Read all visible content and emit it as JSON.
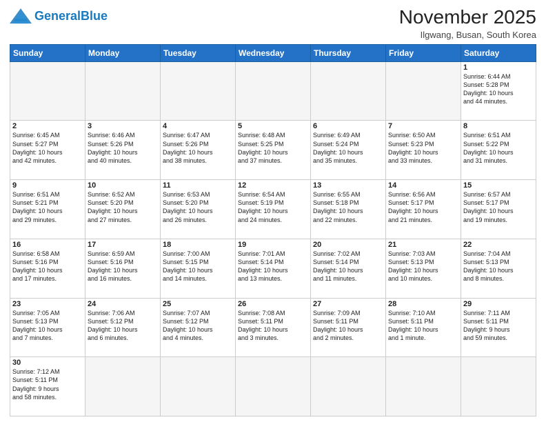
{
  "header": {
    "logo_general": "General",
    "logo_blue": "Blue",
    "title": "November 2025",
    "location": "Ilgwang, Busan, South Korea"
  },
  "days_of_week": [
    "Sunday",
    "Monday",
    "Tuesday",
    "Wednesday",
    "Thursday",
    "Friday",
    "Saturday"
  ],
  "weeks": [
    [
      {
        "day": "",
        "info": ""
      },
      {
        "day": "",
        "info": ""
      },
      {
        "day": "",
        "info": ""
      },
      {
        "day": "",
        "info": ""
      },
      {
        "day": "",
        "info": ""
      },
      {
        "day": "",
        "info": ""
      },
      {
        "day": "1",
        "info": "Sunrise: 6:44 AM\nSunset: 5:28 PM\nDaylight: 10 hours\nand 44 minutes."
      }
    ],
    [
      {
        "day": "2",
        "info": "Sunrise: 6:45 AM\nSunset: 5:27 PM\nDaylight: 10 hours\nand 42 minutes."
      },
      {
        "day": "3",
        "info": "Sunrise: 6:46 AM\nSunset: 5:26 PM\nDaylight: 10 hours\nand 40 minutes."
      },
      {
        "day": "4",
        "info": "Sunrise: 6:47 AM\nSunset: 5:26 PM\nDaylight: 10 hours\nand 38 minutes."
      },
      {
        "day": "5",
        "info": "Sunrise: 6:48 AM\nSunset: 5:25 PM\nDaylight: 10 hours\nand 37 minutes."
      },
      {
        "day": "6",
        "info": "Sunrise: 6:49 AM\nSunset: 5:24 PM\nDaylight: 10 hours\nand 35 minutes."
      },
      {
        "day": "7",
        "info": "Sunrise: 6:50 AM\nSunset: 5:23 PM\nDaylight: 10 hours\nand 33 minutes."
      },
      {
        "day": "8",
        "info": "Sunrise: 6:51 AM\nSunset: 5:22 PM\nDaylight: 10 hours\nand 31 minutes."
      }
    ],
    [
      {
        "day": "9",
        "info": "Sunrise: 6:51 AM\nSunset: 5:21 PM\nDaylight: 10 hours\nand 29 minutes."
      },
      {
        "day": "10",
        "info": "Sunrise: 6:52 AM\nSunset: 5:20 PM\nDaylight: 10 hours\nand 27 minutes."
      },
      {
        "day": "11",
        "info": "Sunrise: 6:53 AM\nSunset: 5:20 PM\nDaylight: 10 hours\nand 26 minutes."
      },
      {
        "day": "12",
        "info": "Sunrise: 6:54 AM\nSunset: 5:19 PM\nDaylight: 10 hours\nand 24 minutes."
      },
      {
        "day": "13",
        "info": "Sunrise: 6:55 AM\nSunset: 5:18 PM\nDaylight: 10 hours\nand 22 minutes."
      },
      {
        "day": "14",
        "info": "Sunrise: 6:56 AM\nSunset: 5:17 PM\nDaylight: 10 hours\nand 21 minutes."
      },
      {
        "day": "15",
        "info": "Sunrise: 6:57 AM\nSunset: 5:17 PM\nDaylight: 10 hours\nand 19 minutes."
      }
    ],
    [
      {
        "day": "16",
        "info": "Sunrise: 6:58 AM\nSunset: 5:16 PM\nDaylight: 10 hours\nand 17 minutes."
      },
      {
        "day": "17",
        "info": "Sunrise: 6:59 AM\nSunset: 5:16 PM\nDaylight: 10 hours\nand 16 minutes."
      },
      {
        "day": "18",
        "info": "Sunrise: 7:00 AM\nSunset: 5:15 PM\nDaylight: 10 hours\nand 14 minutes."
      },
      {
        "day": "19",
        "info": "Sunrise: 7:01 AM\nSunset: 5:14 PM\nDaylight: 10 hours\nand 13 minutes."
      },
      {
        "day": "20",
        "info": "Sunrise: 7:02 AM\nSunset: 5:14 PM\nDaylight: 10 hours\nand 11 minutes."
      },
      {
        "day": "21",
        "info": "Sunrise: 7:03 AM\nSunset: 5:13 PM\nDaylight: 10 hours\nand 10 minutes."
      },
      {
        "day": "22",
        "info": "Sunrise: 7:04 AM\nSunset: 5:13 PM\nDaylight: 10 hours\nand 8 minutes."
      }
    ],
    [
      {
        "day": "23",
        "info": "Sunrise: 7:05 AM\nSunset: 5:13 PM\nDaylight: 10 hours\nand 7 minutes."
      },
      {
        "day": "24",
        "info": "Sunrise: 7:06 AM\nSunset: 5:12 PM\nDaylight: 10 hours\nand 6 minutes."
      },
      {
        "day": "25",
        "info": "Sunrise: 7:07 AM\nSunset: 5:12 PM\nDaylight: 10 hours\nand 4 minutes."
      },
      {
        "day": "26",
        "info": "Sunrise: 7:08 AM\nSunset: 5:11 PM\nDaylight: 10 hours\nand 3 minutes."
      },
      {
        "day": "27",
        "info": "Sunrise: 7:09 AM\nSunset: 5:11 PM\nDaylight: 10 hours\nand 2 minutes."
      },
      {
        "day": "28",
        "info": "Sunrise: 7:10 AM\nSunset: 5:11 PM\nDaylight: 10 hours\nand 1 minute."
      },
      {
        "day": "29",
        "info": "Sunrise: 7:11 AM\nSunset: 5:11 PM\nDaylight: 9 hours\nand 59 minutes."
      }
    ],
    [
      {
        "day": "30",
        "info": "Sunrise: 7:12 AM\nSunset: 5:11 PM\nDaylight: 9 hours\nand 58 minutes."
      },
      {
        "day": "",
        "info": ""
      },
      {
        "day": "",
        "info": ""
      },
      {
        "day": "",
        "info": ""
      },
      {
        "day": "",
        "info": ""
      },
      {
        "day": "",
        "info": ""
      },
      {
        "day": "",
        "info": ""
      }
    ]
  ]
}
